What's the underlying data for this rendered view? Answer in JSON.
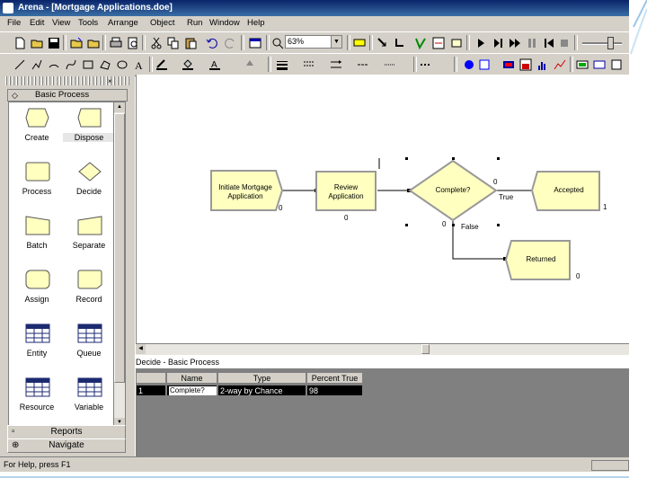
{
  "window": {
    "title": "Arena - [Mortgage Applications.doe]"
  },
  "menu": [
    "File",
    "Edit",
    "View",
    "Tools",
    "Arrange",
    "Object",
    "Run",
    "Window",
    "Help"
  ],
  "toolbar": {
    "zoom_value": "63%"
  },
  "project_bar": {
    "panel_title": "Basic Process",
    "modules": [
      {
        "label": "Create",
        "icon": "create-shape-icon"
      },
      {
        "label": "Dispose",
        "icon": "dispose-shape-icon"
      },
      {
        "label": "Process",
        "icon": "process-shape-icon"
      },
      {
        "label": "Decide",
        "icon": "decide-shape-icon"
      },
      {
        "label": "Batch",
        "icon": "batch-shape-icon"
      },
      {
        "label": "Separate",
        "icon": "separate-shape-icon"
      },
      {
        "label": "Assign",
        "icon": "assign-shape-icon"
      },
      {
        "label": "Record",
        "icon": "record-shape-icon"
      },
      {
        "label": "Entity",
        "icon": "table-icon"
      },
      {
        "label": "Queue",
        "icon": "table-icon"
      },
      {
        "label": "Resource",
        "icon": "table-icon"
      },
      {
        "label": "Variable",
        "icon": "table-icon"
      }
    ],
    "reports_label": "Reports",
    "navigate_label": "Navigate"
  },
  "flowchart": {
    "create": {
      "label_line1": "Initiate Mortgage",
      "label_line2": "Application",
      "count": "0"
    },
    "process": {
      "label_line1": "Review",
      "label_line2": "Application",
      "count": "0"
    },
    "decide": {
      "label": "Complete?",
      "count_top": "0",
      "true_label": "True",
      "count_bottom": "0",
      "false_label": "False"
    },
    "dispose_accepted": {
      "label": "Accepted",
      "count": "1"
    },
    "dispose_returned": {
      "label": "Returned",
      "count": "0"
    }
  },
  "sheet": {
    "title": "Decide - Basic Process",
    "headers": [
      "Name",
      "Type",
      "Percent True"
    ],
    "rows": [
      {
        "num": "1",
        "name": "Complete?",
        "type": "2-way by Chance",
        "percent": "98"
      }
    ]
  },
  "status": {
    "text": "For Help, press F1"
  },
  "colors": {
    "module_fill": "#ffffc0",
    "titlebar": "#0a246a",
    "chrome": "#d4d0c8"
  }
}
